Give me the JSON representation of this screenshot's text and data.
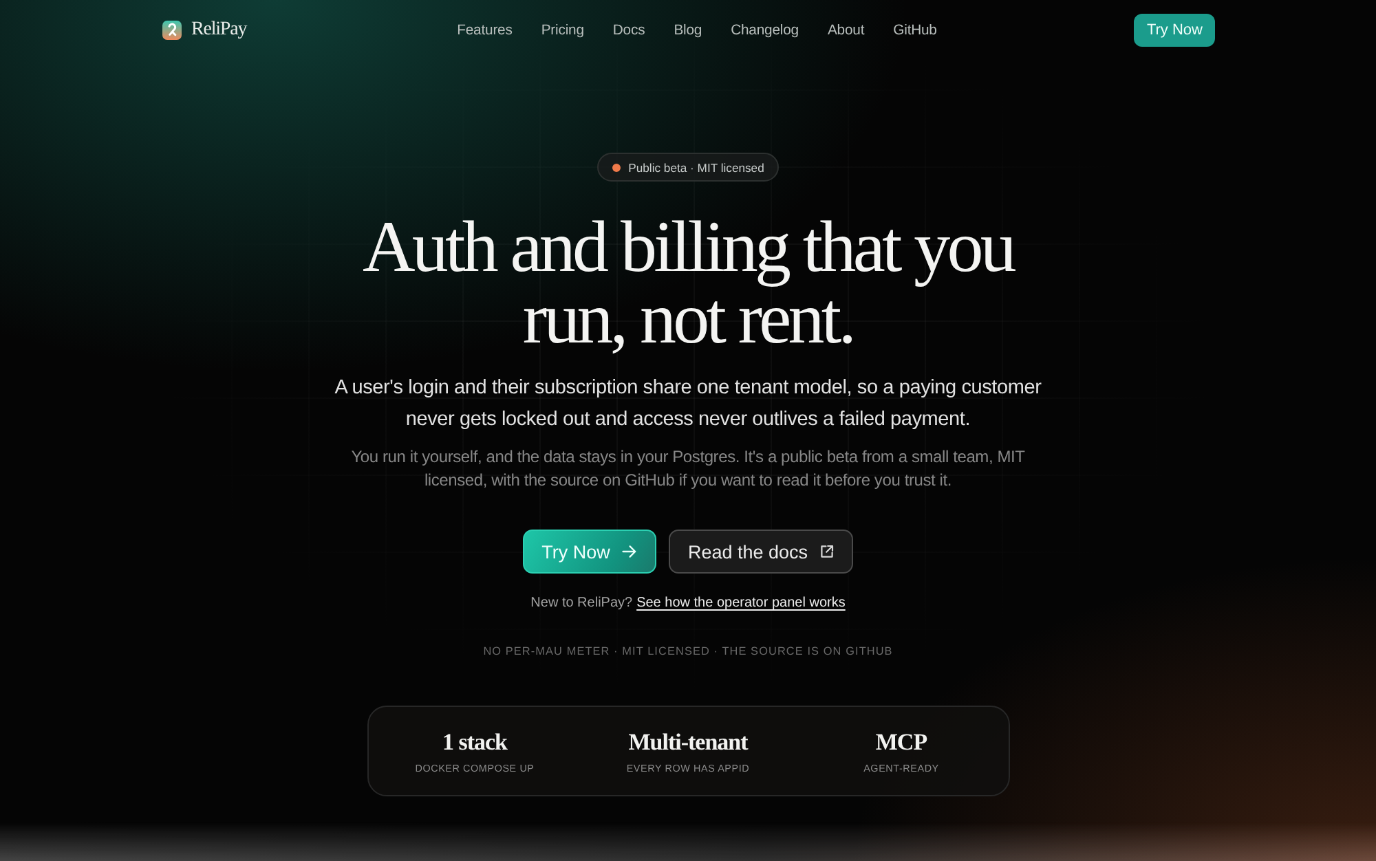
{
  "nav": {
    "logo": "ReliPay",
    "links": [
      "Features",
      "Pricing",
      "Docs",
      "Blog",
      "Changelog",
      "About",
      "GitHub"
    ],
    "cta": "Try Now"
  },
  "hero": {
    "badge": "Public beta · MIT licensed",
    "title": "Auth and billing that you run, not rent.",
    "lead": "A user's login and their subscription share one tenant model, so a paying customer never gets locked out and access never outlives a failed payment.",
    "note": "You run it yourself, and the data stays in your Postgres. It's a public beta from a small team, MIT licensed, with the source on GitHub if you want to read it before you trust it.",
    "buttons": [
      {
        "label": "Try Now",
        "kind": "primary"
      },
      {
        "label": "Read the docs",
        "kind": "secondary"
      }
    ],
    "intro": {
      "text": "New to ReliPay?",
      "link": "See how the operator panel works"
    },
    "tagline": "NO PER-MAU METER · MIT LICENSED · THE SOURCE IS ON GITHUB"
  },
  "stats": [
    {
      "value": "1 stack",
      "label": "DOCKER COMPOSE UP"
    },
    {
      "value": "Multi-tenant",
      "label": "EVERY ROW HAS APPID"
    },
    {
      "value": "MCP",
      "label": "AGENT-READY"
    }
  ]
}
